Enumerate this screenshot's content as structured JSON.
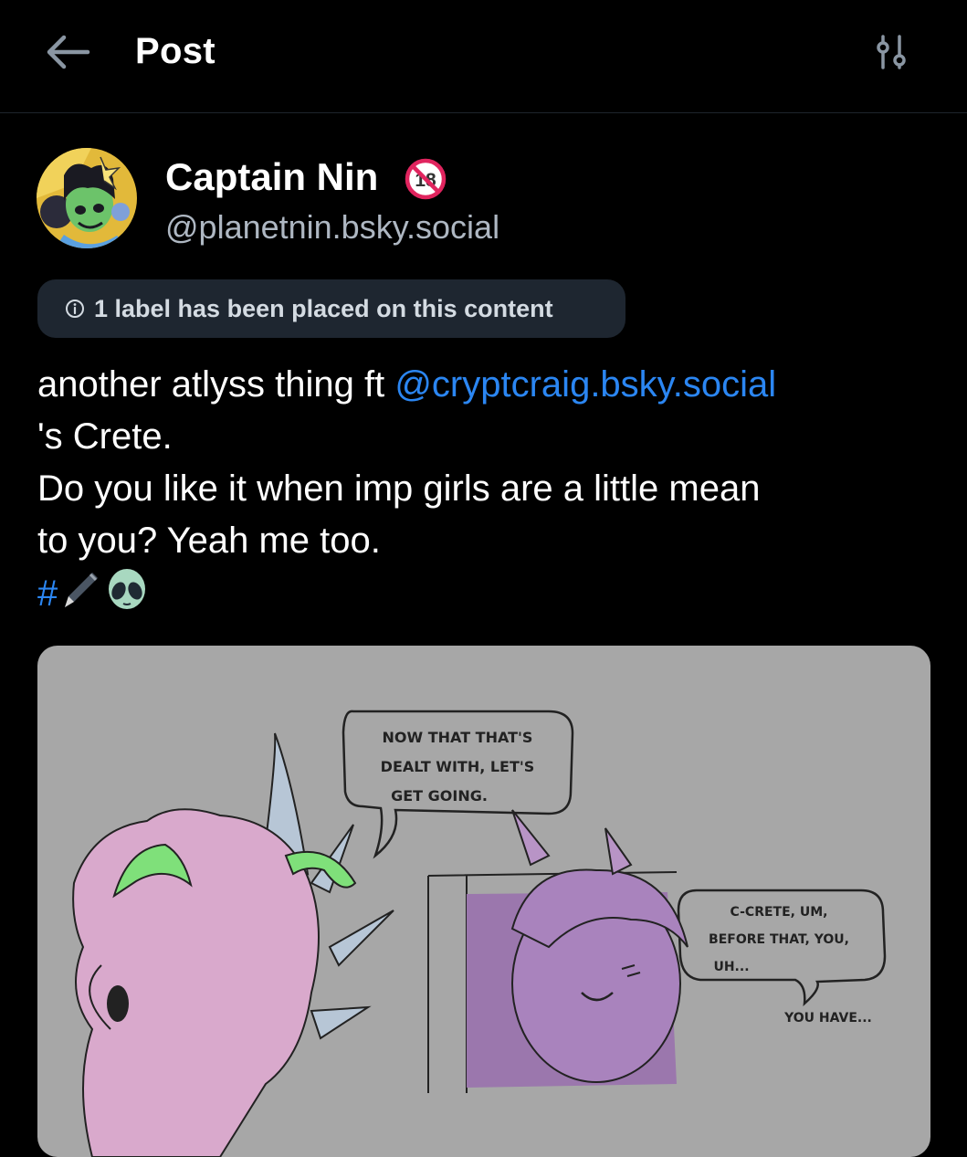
{
  "header": {
    "title": "Post",
    "back_icon": "arrow-left-icon",
    "filter_icon": "sliders-icon"
  },
  "author": {
    "display_name": "Captain Nin",
    "handle": "@planetnin.bsky.social",
    "badge_icon": "adult-18-icon"
  },
  "moderation": {
    "label_text": "1 label has been placed on this content",
    "icon": "info-circle-icon"
  },
  "post": {
    "text_before_mention": "another atlyss thing ft ",
    "mention": "@cryptcraig.bsky.social",
    "line2": "'s Crete.",
    "line3": "Do you like it when imp girls are a little mean",
    "line4": "to you? Yeah me too.",
    "hashtag": "#",
    "emojis": [
      "pen-icon",
      "alien-icon"
    ]
  },
  "comic": {
    "bubble1": [
      "NOW THAT THAT'S",
      "DEALT WITH, LET'S",
      "GET GOING."
    ],
    "bubble2": [
      "C-CRETE, UM,",
      "BEFORE THAT, YOU,",
      "UH..."
    ],
    "caption": "YOU HAVE..."
  },
  "colors": {
    "background": "#000000",
    "accent_link": "#2b86f2",
    "pill_bg": "#1e2630",
    "muted_text": "#aeb7c2"
  }
}
